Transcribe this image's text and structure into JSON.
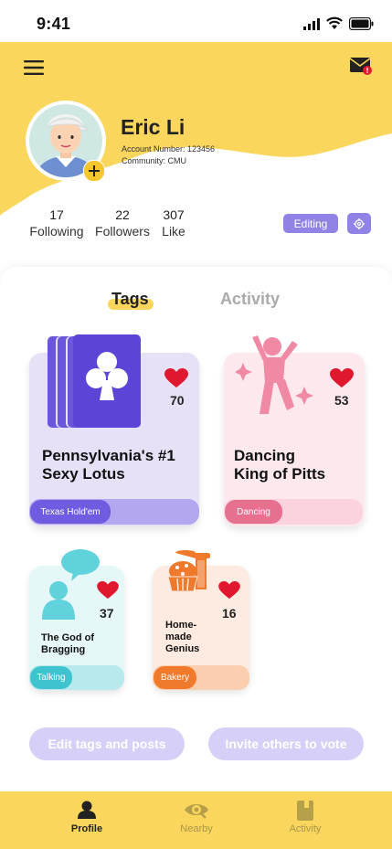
{
  "status_bar": {
    "time": "9:41"
  },
  "profile": {
    "name": "Eric Li",
    "account_number": "Account Number: 123456",
    "community": "Community: CMU",
    "stats": [
      {
        "value": "17",
        "label": "Following"
      },
      {
        "value": "22",
        "label": "Followers"
      },
      {
        "value": "307",
        "label": "Like"
      }
    ],
    "editing_label": "Editing"
  },
  "tabs": [
    {
      "label": "Tags",
      "active": true
    },
    {
      "label": "Activity",
      "active": false
    }
  ],
  "tags": [
    {
      "title_line1": "Pennsylvania's #1",
      "title_line2": "Sexy Lotus",
      "likes": "70",
      "chip": "Texas Hold'em",
      "chip_color": "#6f5ce0",
      "card_color": "#e6e1f6",
      "track_color": "#b3a8ef"
    },
    {
      "title_line1": "Dancing",
      "title_line2": "King of Pitts",
      "likes": "53",
      "chip": "Dancing",
      "chip_color": "#e8708f",
      "card_color": "#fde8ee",
      "track_color": "#fbd3de"
    },
    {
      "title_line1": "The God of",
      "title_line2": "Bragging",
      "likes": "37",
      "chip": "Talking",
      "chip_color": "#3fc4cf",
      "card_color": "#e6f7f8",
      "track_color": "#b7e9ed"
    },
    {
      "title_line1": "Home-",
      "title_line2": "made",
      "title_line3": "Genius",
      "likes": "16",
      "chip": "Bakery",
      "chip_color": "#f07a2c",
      "card_color": "#fdebe1",
      "track_color": "#fbcfae"
    }
  ],
  "actions": {
    "edit_tags": "Edit tags and posts",
    "invite": "Invite others to vote"
  },
  "nav": [
    {
      "label": "Profile",
      "active": true
    },
    {
      "label": "Nearby",
      "active": false
    },
    {
      "label": "Activity",
      "active": false
    }
  ],
  "colors": {
    "brand_yellow": "#fad65c",
    "accent_purple": "#8f83e6",
    "heart_red": "#e0182d"
  }
}
